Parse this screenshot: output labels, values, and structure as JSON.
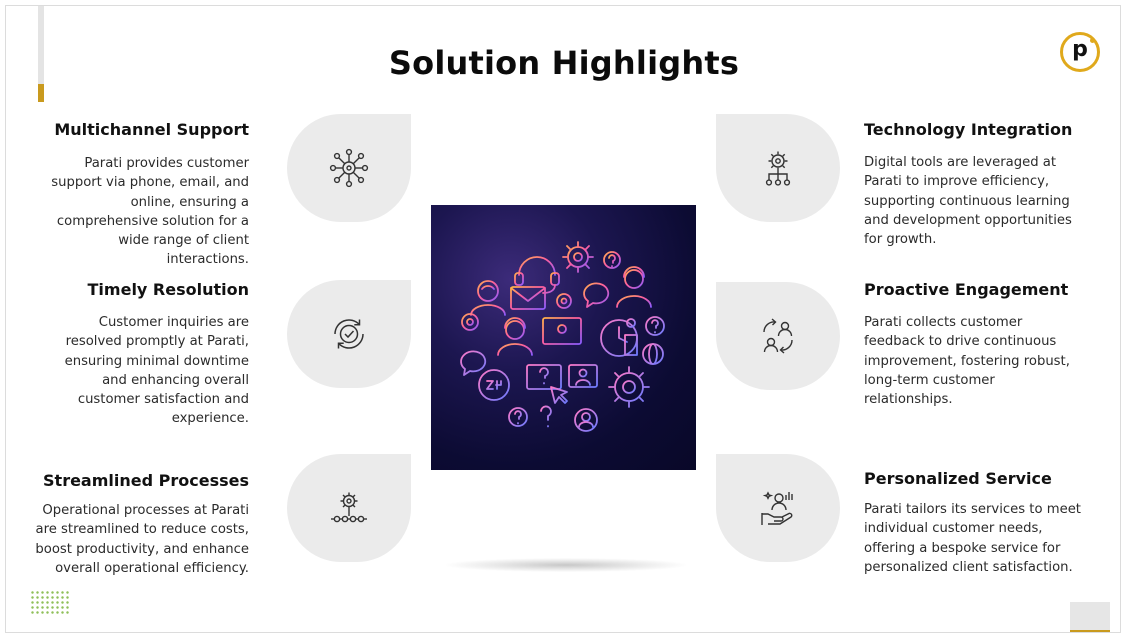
{
  "slide": {
    "title": "Solution Highlights",
    "logo_letter": "p",
    "colors": {
      "accent_gold": "#c99a1e",
      "leaf_gray": "#ebebeb",
      "title": "#0b0b0b"
    }
  },
  "left_items": [
    {
      "title": "Multichannel Support",
      "text": "Parati provides customer support via phone, email, and online, ensuring a comprehensive solution for a wide range of client interactions.",
      "icon": "network-hub-icon"
    },
    {
      "title": "Timely Resolution",
      "text": "Customer inquiries are resolved promptly at Parati, ensuring minimal downtime and enhancing overall customer satisfaction and experience.",
      "icon": "check-cycle-icon"
    },
    {
      "title": "Streamlined Processes",
      "text": "Operational processes at Parati are streamlined to reduce costs, boost productivity, and enhance overall operational efficiency.",
      "icon": "gear-workflow-icon"
    }
  ],
  "right_items": [
    {
      "title": "Technology Integration",
      "text": "Digital tools are leveraged at Parati to improve efficiency, supporting continuous learning and development opportunities for growth.",
      "icon": "gear-network-icon"
    },
    {
      "title": "Proactive Engagement",
      "text": "Parati collects customer feedback to drive continuous improvement, fostering robust, long-term customer relationships.",
      "icon": "people-exchange-icon"
    },
    {
      "title": "Personalized Service",
      "text": "Parati tailors its services to meet individual customer needs, offering a bespoke service for personalized client satisfaction.",
      "icon": "hand-person-icon"
    }
  ]
}
